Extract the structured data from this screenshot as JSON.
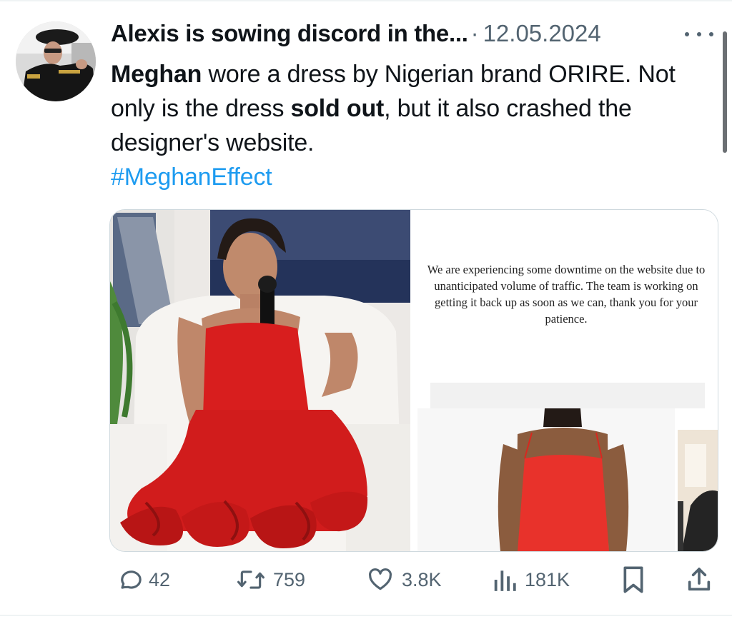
{
  "tweet": {
    "author_display_name": "Alexis is sowing discord in the...",
    "separator": "·",
    "date": "12.05.2024",
    "more_menu_icon": "more-horizontal-icon",
    "text": {
      "bold_1": "Meghan",
      "part_1": " wore a dress by Nigerian brand ORIRE. Not only is the dress ",
      "bold_2": "sold out",
      "part_2": ", but it also crashed the designer's website.",
      "hashtag": "#MeghanEffect"
    },
    "media": {
      "notice_text": "We are experiencing some downtime on the website due to unanticipated volume of traffic. The team is working on getting it back up as soon as we can, thank you for your patience."
    },
    "actions": {
      "replies": {
        "icon": "reply-icon",
        "count": "42"
      },
      "reposts": {
        "icon": "repost-icon",
        "count": "759"
      },
      "likes": {
        "icon": "heart-icon",
        "count": "3.8K"
      },
      "views": {
        "icon": "views-bar-chart-icon",
        "count": "181K"
      },
      "bookmark": {
        "icon": "bookmark-icon"
      },
      "share": {
        "icon": "share-icon"
      }
    }
  },
  "colors": {
    "text_primary": "#0f1419",
    "text_secondary": "#536471",
    "link": "#1d9bf0",
    "dress_red": "#d81e1e"
  }
}
